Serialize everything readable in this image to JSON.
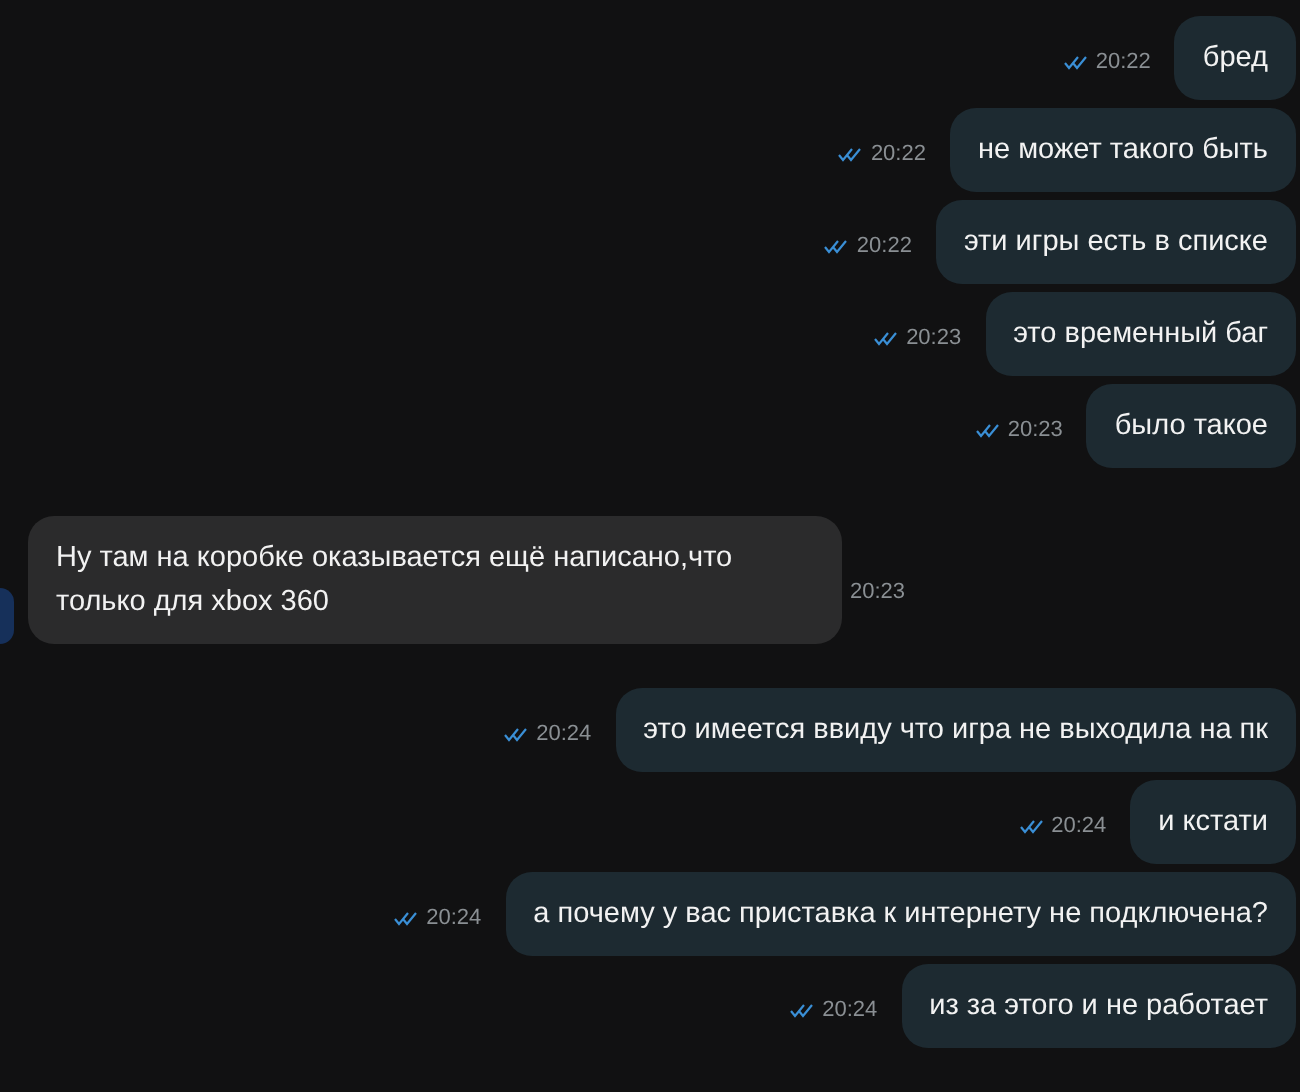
{
  "messages": [
    {
      "kind": "outgoing",
      "text": "бред",
      "time": "20:22",
      "read": true
    },
    {
      "kind": "outgoing",
      "text": "не может такого быть",
      "time": "20:22",
      "read": true
    },
    {
      "kind": "outgoing",
      "text": "эти игры есть в списке",
      "time": "20:22",
      "read": true
    },
    {
      "kind": "outgoing",
      "text": "это временный баг",
      "time": "20:23",
      "read": true
    },
    {
      "kind": "outgoing",
      "text": "было такое",
      "time": "20:23",
      "read": true
    },
    {
      "kind": "incoming",
      "text": "Ну там на коробке оказывается ещё написано,что только для xbox 360",
      "time": "20:23"
    },
    {
      "kind": "outgoing",
      "text": "это имеется ввиду что игра не выходила на пк",
      "time": "20:24",
      "read": true
    },
    {
      "kind": "outgoing",
      "text": "и кстати",
      "time": "20:24",
      "read": true
    },
    {
      "kind": "outgoing",
      "text": "а почему у вас приставка к интернету не подключена?",
      "time": "20:24",
      "read": true
    },
    {
      "kind": "outgoing",
      "text": "из за этого и не работает",
      "time": "20:24",
      "read": true
    }
  ]
}
